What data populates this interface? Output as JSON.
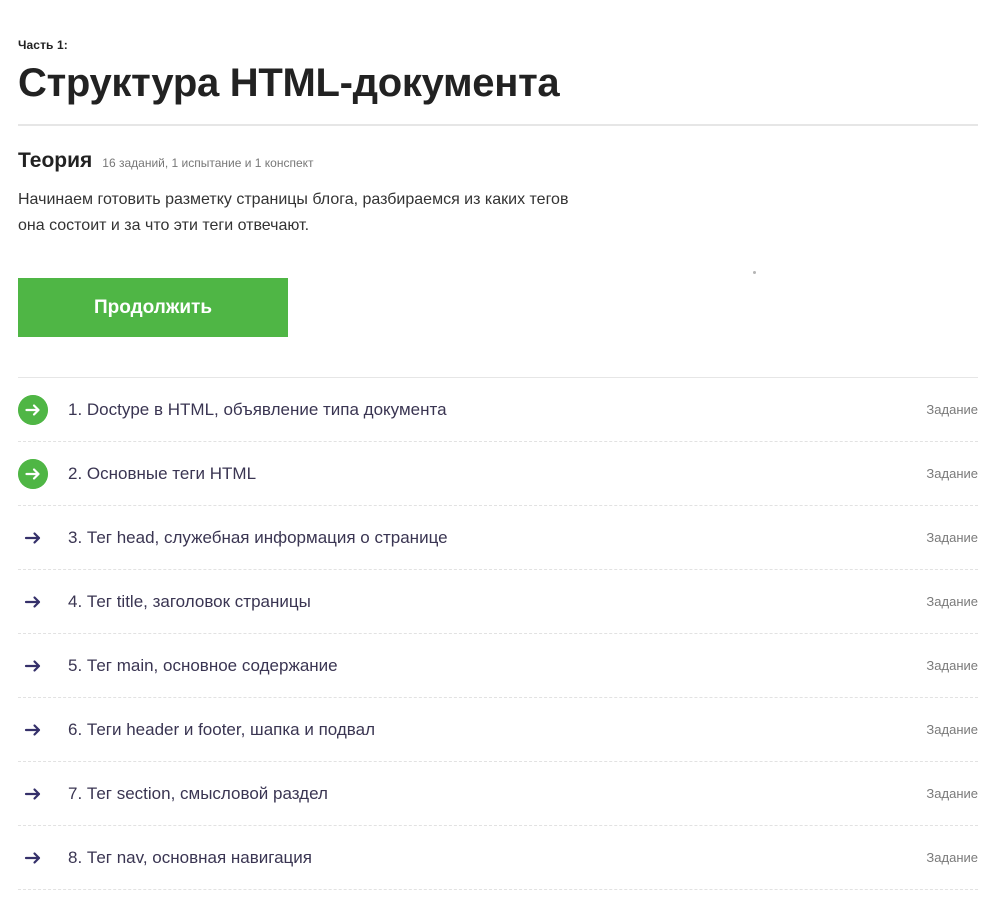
{
  "part": {
    "label": "Часть 1:",
    "title": "Структура HTML-документа"
  },
  "section": {
    "title": "Теория",
    "meta": "16 заданий, 1 испытание и 1 конспект",
    "description": "Начинаем готовить разметку страницы блога, разбираемся из каких тегов она состоит и за что эти теги отвечают.",
    "continue_label": "Продолжить"
  },
  "tasks": [
    {
      "title": "1. Doctype в HTML, объявление типа документа",
      "type": "Задание",
      "icon": "arrow-right-circle-icon",
      "completed": true
    },
    {
      "title": "2. Основные теги HTML",
      "type": "Задание",
      "icon": "arrow-right-circle-icon",
      "completed": true
    },
    {
      "title": "3. Тег head, служебная информация о странице",
      "type": "Задание",
      "icon": "arrow-right-icon",
      "completed": false
    },
    {
      "title": "4. Тег title, заголовок страницы",
      "type": "Задание",
      "icon": "arrow-right-icon",
      "completed": false
    },
    {
      "title": "5. Тег main, основное содержание",
      "type": "Задание",
      "icon": "arrow-right-icon",
      "completed": false
    },
    {
      "title": "6. Теги header и footer, шапка и подвал",
      "type": "Задание",
      "icon": "arrow-right-icon",
      "completed": false
    },
    {
      "title": "7. Тег section, смысловой раздел",
      "type": "Задание",
      "icon": "arrow-right-icon",
      "completed": false
    },
    {
      "title": "8. Тег nav, основная навигация",
      "type": "Задание",
      "icon": "arrow-right-icon",
      "completed": false
    }
  ],
  "colors": {
    "accent_green": "#4fb645",
    "arrow_dark": "#35306a",
    "title_text": "#222222",
    "task_text": "#3a3552",
    "muted_text": "#7a7a7a"
  }
}
